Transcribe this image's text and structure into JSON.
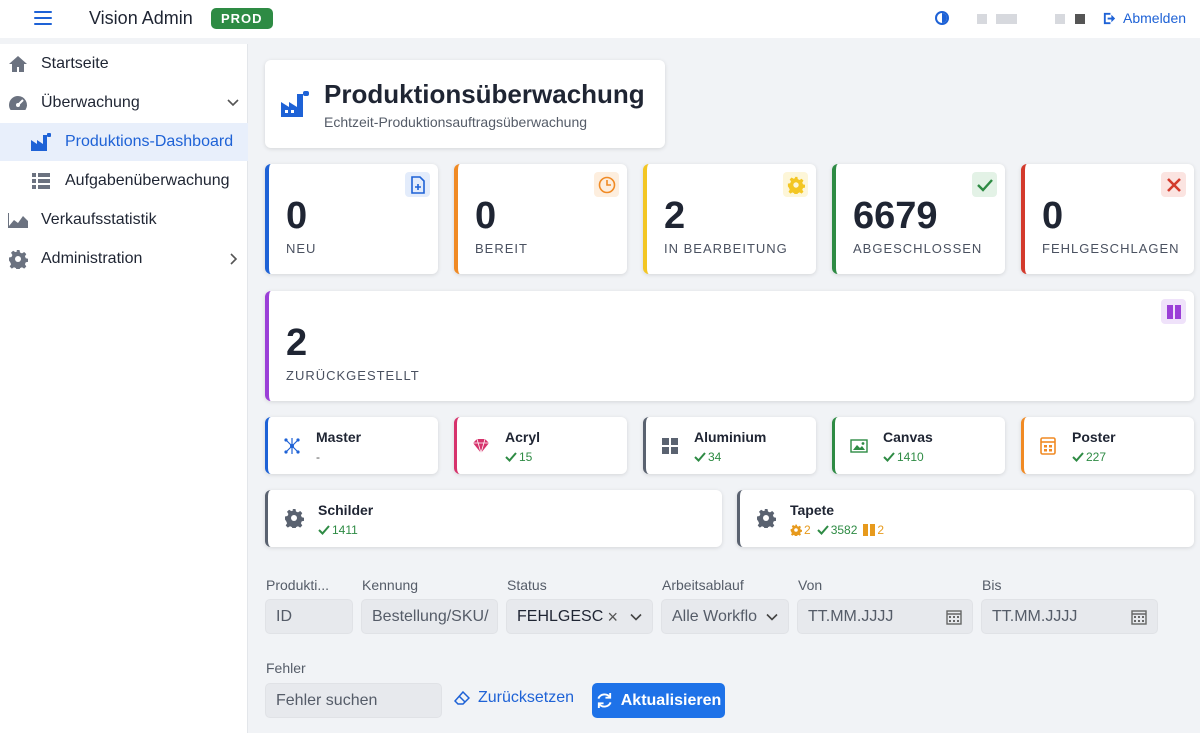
{
  "app": {
    "title": "Vision Admin",
    "env": "PROD",
    "logout_label": "Abmelden"
  },
  "sidebar": {
    "items": [
      {
        "label": "Startseite",
        "icon": "home-icon"
      },
      {
        "label": "Überwachung",
        "icon": "dashboard-gauge-icon"
      },
      {
        "label": "Produktions-Dashboard",
        "icon": "factory-icon",
        "active": true
      },
      {
        "label": "Aufgabenüberwachung",
        "icon": "list-icon"
      },
      {
        "label": "Verkaufsstatistik",
        "icon": "area-chart-icon"
      },
      {
        "label": "Administration",
        "icon": "gear-icon"
      }
    ]
  },
  "header": {
    "title": "Produktionsüberwachung",
    "subtitle": "Echtzeit-Produktionsauftragsüberwachung"
  },
  "stats": [
    {
      "value": "0",
      "label": "NEU",
      "color": "#1e62d6"
    },
    {
      "value": "0",
      "label": "BEREIT",
      "color": "#f08a24"
    },
    {
      "value": "2",
      "label": "IN BEARBEITUNG",
      "color": "#f3c623"
    },
    {
      "value": "6679",
      "label": "ABGESCHLOSSEN",
      "color": "#2e8b44"
    },
    {
      "value": "0",
      "label": "FEHLGESCHLAGEN",
      "color": "#d33a2c"
    }
  ],
  "deferred": {
    "value": "2",
    "label": "ZURÜCKGESTELLT",
    "color": "#9b3fd7"
  },
  "products": [
    {
      "name": "Master",
      "meta": "-",
      "color": "#1e62d6"
    },
    {
      "name": "Acryl",
      "done": "15",
      "color": "#d6336c"
    },
    {
      "name": "Aluminium",
      "done": "34",
      "color": "#5a6270"
    },
    {
      "name": "Canvas",
      "done": "1410",
      "color": "#2e8b44"
    },
    {
      "name": "Poster",
      "done": "227",
      "color": "#f08a24"
    },
    {
      "name": "Schilder",
      "done": "1411",
      "color": "#5a6270"
    },
    {
      "name": "Tapete",
      "processing": "2",
      "done": "3582",
      "deferred": "2",
      "color": "#5a6270"
    }
  ],
  "filters": {
    "id": {
      "label": "Produkti...",
      "placeholder": "ID"
    },
    "kennung": {
      "label": "Kennung",
      "placeholder": "Bestellung/SKU/"
    },
    "status": {
      "label": "Status",
      "value": "FEHLGESC"
    },
    "workflow": {
      "label": "Arbeitsablauf",
      "value": "Alle Workflo"
    },
    "von": {
      "label": "Von",
      "placeholder": "TT.MM.JJJJ"
    },
    "bis": {
      "label": "Bis",
      "placeholder": "TT.MM.JJJJ"
    },
    "fehler": {
      "label": "Fehler",
      "placeholder": "Fehler suchen"
    },
    "reset_label": "Zurücksetzen",
    "refresh_label": "Aktualisieren"
  }
}
